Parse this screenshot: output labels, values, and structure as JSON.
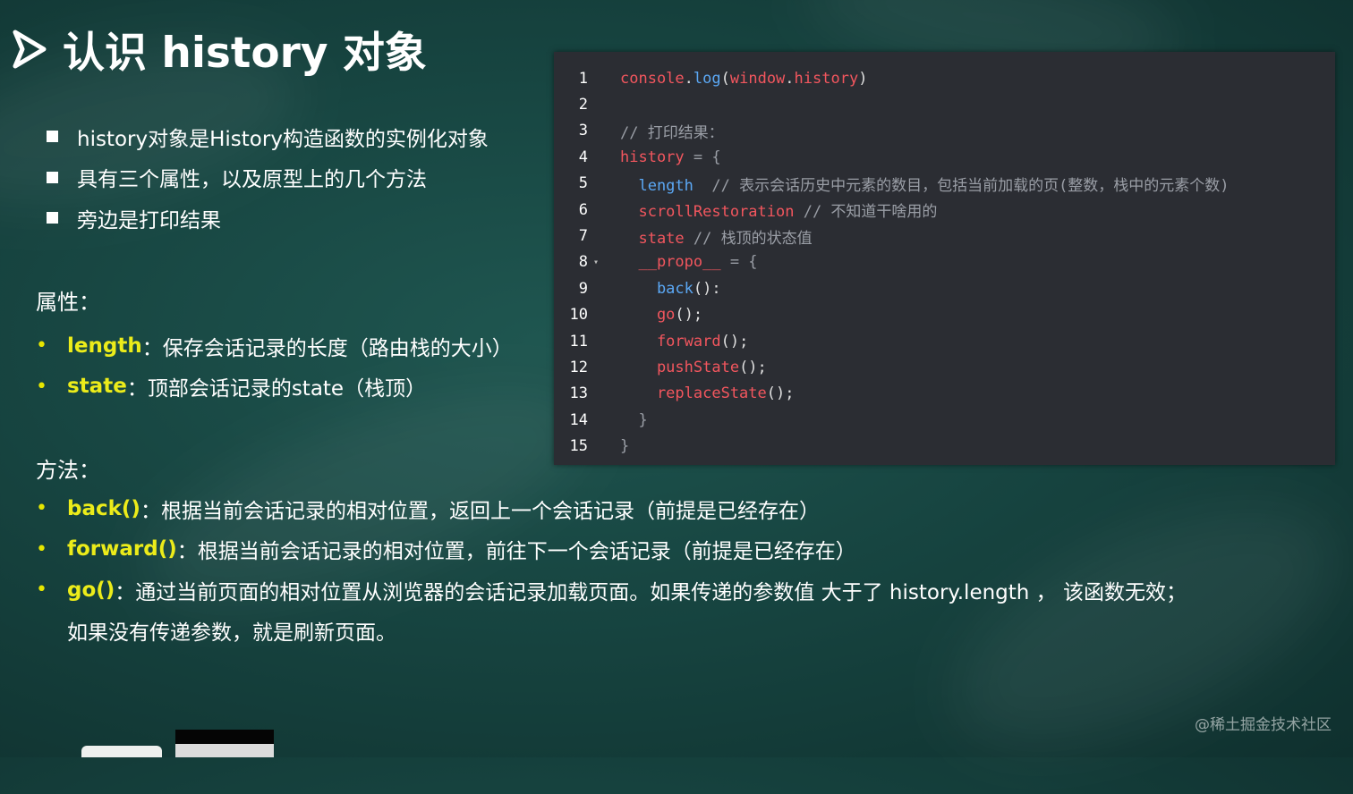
{
  "title": "认识 history 对象",
  "bullets": [
    "history对象是History构造函数的实例化对象",
    "具有三个属性，以及原型上的几个方法",
    "旁边是打印结果"
  ],
  "properties": {
    "heading": "属性：",
    "items": [
      {
        "keyword": "length",
        "text": "：保存会话记录的长度（路由栈的大小）"
      },
      {
        "keyword": "state",
        "text": "：顶部会话记录的state（栈顶）"
      }
    ]
  },
  "methods": {
    "heading": "方法：",
    "items": [
      {
        "keyword": "back()",
        "text": "：根据当前会话记录的相对位置，返回上一个会话记录（前提是已经存在）"
      },
      {
        "keyword": "forward()",
        "text": "：根据当前会话记录的相对位置，前往下一个会话记录（前提是已经存在）"
      },
      {
        "keyword": "go()",
        "text": "：通过当前页面的相对位置从浏览器的会话记录加载页面。如果传递的参数值 大于了 history.length ， 该函数无效；"
      }
    ],
    "continuation": "如果没有传递参数，就是刷新页面。"
  },
  "code": {
    "lines": [
      {
        "num": "1",
        "tokens": [
          {
            "c": "red",
            "t": "console"
          },
          {
            "c": "white",
            "t": "."
          },
          {
            "c": "blue",
            "t": "log"
          },
          {
            "c": "white",
            "t": "("
          },
          {
            "c": "red",
            "t": "window"
          },
          {
            "c": "white",
            "t": "."
          },
          {
            "c": "red",
            "t": "history"
          },
          {
            "c": "white",
            "t": ")"
          }
        ]
      },
      {
        "num": "2",
        "tokens": []
      },
      {
        "num": "3",
        "tokens": [
          {
            "c": "gray",
            "t": "// 打印结果："
          }
        ]
      },
      {
        "num": "4",
        "tokens": [
          {
            "c": "red",
            "t": "history"
          },
          {
            "c": "gray",
            "t": " = {"
          }
        ]
      },
      {
        "num": "5",
        "tokens": [
          {
            "c": "blue",
            "t": "  length"
          },
          {
            "c": "gray",
            "t": "  // 表示会话历史中元素的数目，包括当前加载的页(整数，栈中的元素个数)"
          }
        ]
      },
      {
        "num": "6",
        "tokens": [
          {
            "c": "red",
            "t": "  scrollRestoration"
          },
          {
            "c": "gray",
            "t": " // 不知道干啥用的"
          }
        ]
      },
      {
        "num": "7",
        "tokens": [
          {
            "c": "red",
            "t": "  state"
          },
          {
            "c": "gray",
            "t": " // 栈顶的状态值"
          }
        ]
      },
      {
        "num": "8",
        "fold": "▾",
        "tokens": [
          {
            "c": "red",
            "t": "  __propo__"
          },
          {
            "c": "gray",
            "t": " = {"
          }
        ]
      },
      {
        "num": "9",
        "tokens": [
          {
            "c": "blue",
            "t": "    back"
          },
          {
            "c": "white",
            "t": "():"
          }
        ]
      },
      {
        "num": "10",
        "tokens": [
          {
            "c": "red",
            "t": "    go"
          },
          {
            "c": "white",
            "t": "();"
          }
        ]
      },
      {
        "num": "11",
        "tokens": [
          {
            "c": "red",
            "t": "    forward"
          },
          {
            "c": "white",
            "t": "();"
          }
        ]
      },
      {
        "num": "12",
        "tokens": [
          {
            "c": "red",
            "t": "    pushState"
          },
          {
            "c": "white",
            "t": "();"
          }
        ]
      },
      {
        "num": "13",
        "tokens": [
          {
            "c": "red",
            "t": "    replaceState"
          },
          {
            "c": "white",
            "t": "();"
          }
        ]
      },
      {
        "num": "14",
        "tokens": [
          {
            "c": "gray",
            "t": "  }"
          }
        ]
      },
      {
        "num": "15",
        "tokens": [
          {
            "c": "gray",
            "t": "}"
          }
        ]
      }
    ]
  },
  "watermark": "@稀土掘金技术社区"
}
